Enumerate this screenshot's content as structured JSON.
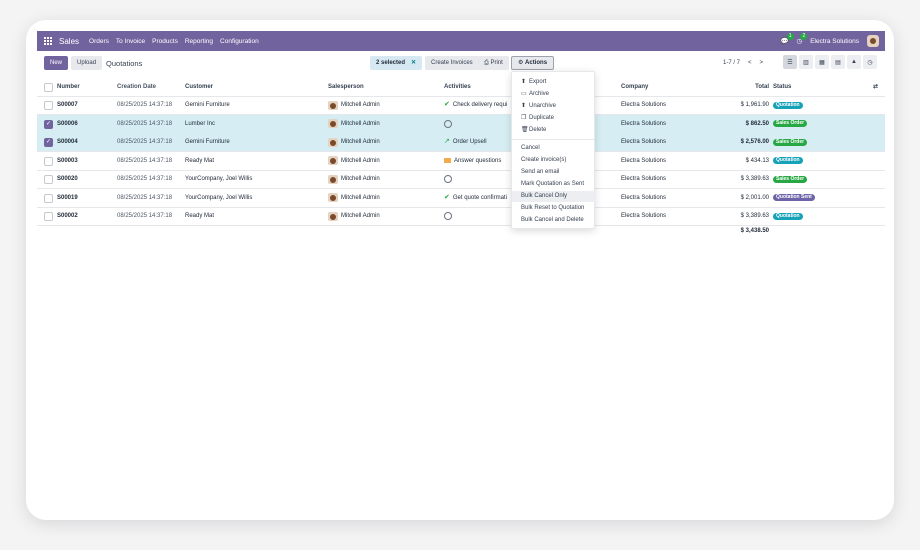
{
  "navbar": {
    "app_name": "Sales",
    "menu": [
      "Orders",
      "To Invoice",
      "Products",
      "Reporting",
      "Configuration"
    ],
    "messages_count": "1",
    "activities_count": "2",
    "company": "Electra Solutions"
  },
  "control_panel": {
    "new_label": "New",
    "upload_label": "Upload",
    "breadcrumb": "Quotations",
    "selected_label": "2 selected",
    "clear_label": "✕",
    "create_invoices_label": "Create Invoices",
    "print_label": "Print",
    "actions_label": "Actions",
    "pager": "1-7 / 7",
    "prev": "<",
    "next": ">"
  },
  "table": {
    "columns": [
      "Number",
      "Creation Date",
      "Customer",
      "Salesperson",
      "Activities",
      "Company",
      "Total",
      "Status"
    ],
    "rows": [
      {
        "number": "S00007",
        "date": "08/25/2025 14:37:18",
        "customer": "Gemini Furniture",
        "salesperson": "Mitchell Admin",
        "activity": "Check delivery requi",
        "activity_icon": "check-icon",
        "company": "Electra Solutions",
        "total": "$ 1,961.90",
        "status": "Quotation",
        "status_color": "#17a2b8",
        "selected": false
      },
      {
        "number": "S00006",
        "date": "08/25/2025 14:37:18",
        "customer": "Lumber Inc",
        "salesperson": "Mitchell Admin",
        "activity": "",
        "activity_icon": "clock-icon",
        "company": "Electra Solutions",
        "total": "$ 862.50",
        "status": "Sales Order",
        "status_color": "#28a745",
        "selected": true
      },
      {
        "number": "S00004",
        "date": "08/25/2025 14:37:18",
        "customer": "Gemini Furniture",
        "salesperson": "Mitchell Admin",
        "activity": "Order Upsell",
        "activity_icon": "trend-icon",
        "company": "Electra Solutions",
        "total": "$ 2,576.00",
        "status": "Sales Order",
        "status_color": "#28a745",
        "selected": true
      },
      {
        "number": "S00003",
        "date": "08/25/2025 14:37:18",
        "customer": "Ready Mat",
        "salesperson": "Mitchell Admin",
        "activity": "Answer questions",
        "activity_icon": "mail-icon",
        "company": "Electra Solutions",
        "total": "$ 434.13",
        "status": "Quotation",
        "status_color": "#17a2b8",
        "selected": false
      },
      {
        "number": "S00020",
        "date": "08/25/2025 14:37:18",
        "customer": "YourCompany, Joel Willis",
        "salesperson": "Mitchell Admin",
        "activity": "",
        "activity_icon": "clock-icon",
        "company": "Electra Solutions",
        "total": "$ 3,389.63",
        "status": "Sales Order",
        "status_color": "#28a745",
        "selected": false
      },
      {
        "number": "S00019",
        "date": "08/25/2025 14:37:18",
        "customer": "YourCompany, Joel Willis",
        "salesperson": "Mitchell Admin",
        "activity": "Get quote confirmati",
        "activity_icon": "check-icon",
        "company": "Electra Solutions",
        "total": "$ 2,001.00",
        "status": "Quotation Sent",
        "status_color": "#6c63a8",
        "selected": false
      },
      {
        "number": "S00002",
        "date": "08/25/2025 14:37:18",
        "customer": "Ready Mat",
        "salesperson": "Mitchell Admin",
        "activity": "",
        "activity_icon": "clock-icon",
        "company": "Electra Solutions",
        "total": "$ 3,389.63",
        "status": "Quotation",
        "status_color": "#17a2b8",
        "selected": false
      }
    ],
    "sum_total": "$ 3,438.50"
  },
  "actions_menu": {
    "group1": [
      {
        "label": "Export",
        "icon": "export-icon",
        "glyph": "⬆"
      },
      {
        "label": "Archive",
        "icon": "archive-icon",
        "glyph": "▭"
      },
      {
        "label": "Unarchive",
        "icon": "unarchive-icon",
        "glyph": "⬆"
      },
      {
        "label": "Duplicate",
        "icon": "duplicate-icon",
        "glyph": "❐"
      },
      {
        "label": "Delete",
        "icon": "trash-icon",
        "glyph": "🗑"
      }
    ],
    "group2": [
      "Cancel",
      "Create invoice(s)",
      "Send an email",
      "Mark Quotation as Sent",
      "Bulk Cancel Only",
      "Bulk Reset to Quotation",
      "Bulk Cancel and Delete"
    ],
    "hovered": "Bulk Cancel Only"
  },
  "colors": {
    "brand": "#71639e",
    "selected_row": "#d6eef3"
  }
}
